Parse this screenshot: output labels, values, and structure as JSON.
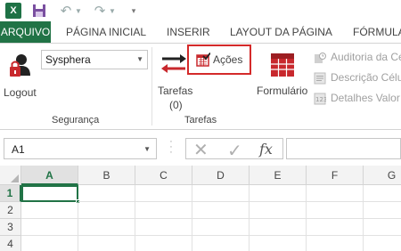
{
  "quick_access": {
    "app_icon_letter": "X",
    "icons": [
      "excel-logo-icon",
      "save-icon",
      "undo-icon",
      "redo-icon",
      "customize-toolbar-icon"
    ]
  },
  "tabs": [
    "ARQUIVO",
    "PÁGINA INICIAL",
    "INSERIR",
    "LAYOUT DA PÁGINA",
    "FÓRMULA"
  ],
  "ribbon": {
    "seguranca": {
      "logout_label": "Logout",
      "user_select_value": "Sysphera",
      "group_label": "Segurança"
    },
    "tarefas": {
      "tarefas_label": "Tarefas",
      "tarefas_count": "(0)",
      "acoes_label": "Ações",
      "group_label": "Tarefas"
    },
    "formulario": {
      "label": "Formulário"
    },
    "side_items": [
      "Auditoria da Cé",
      "Descrição Célu",
      "Detalhes Valor C"
    ]
  },
  "formula_bar": {
    "name_box": "A1",
    "fx_label": "fx",
    "formula_value": ""
  },
  "grid": {
    "columns": [
      "A",
      "B",
      "C",
      "D",
      "E",
      "F",
      "G"
    ],
    "rows": [
      "1",
      "2",
      "3",
      "4"
    ],
    "active_cell": "A1"
  },
  "colors": {
    "excel_green": "#217346",
    "highlight_red": "#d42a2a"
  }
}
